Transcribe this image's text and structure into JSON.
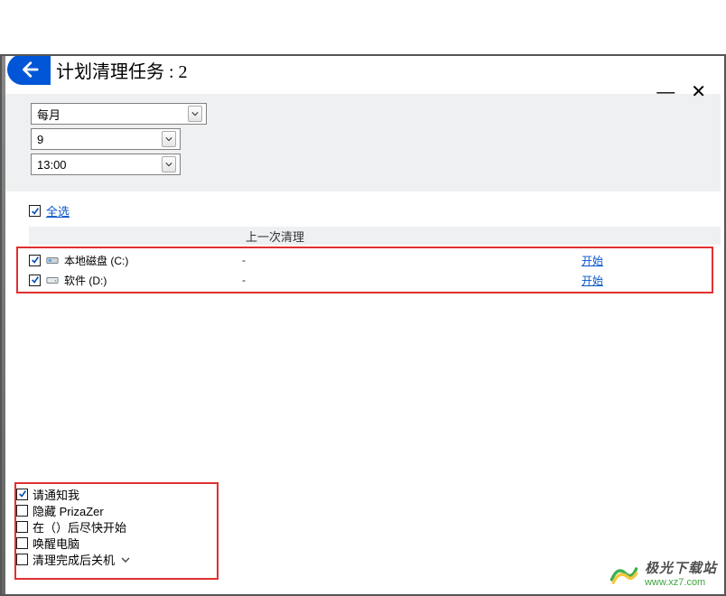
{
  "window": {
    "minimize": "—",
    "close": "✕"
  },
  "header": {
    "title": "计划清理任务 : 2"
  },
  "schedule": {
    "frequency": "每月",
    "day": "9",
    "time": "13:00"
  },
  "table": {
    "select_all_label": "全选",
    "col_last_clean": "上一次清理",
    "rows": [
      {
        "name": "本地磁盘 (C:)",
        "last": "-",
        "action": "开始",
        "icon": "drive-c"
      },
      {
        "name": "软件 (D:)",
        "last": "-",
        "action": "开始",
        "icon": "drive-d"
      }
    ]
  },
  "options": {
    "notify": {
      "label": "请通知我",
      "checked": true
    },
    "hide": {
      "label": "隐藏 PrizaZer",
      "checked": false
    },
    "after": {
      "label": "在（）后尽快开始",
      "checked": false
    },
    "wake": {
      "label": "唤醒电脑",
      "checked": false
    },
    "shutdown": {
      "label": "清理完成后关机",
      "checked": false
    }
  },
  "watermark": {
    "brand": "极光下载站",
    "url": "www.xz7.com"
  },
  "colors": {
    "accent": "#0056d6",
    "highlight": "#e03030",
    "link": "#0956c8"
  }
}
